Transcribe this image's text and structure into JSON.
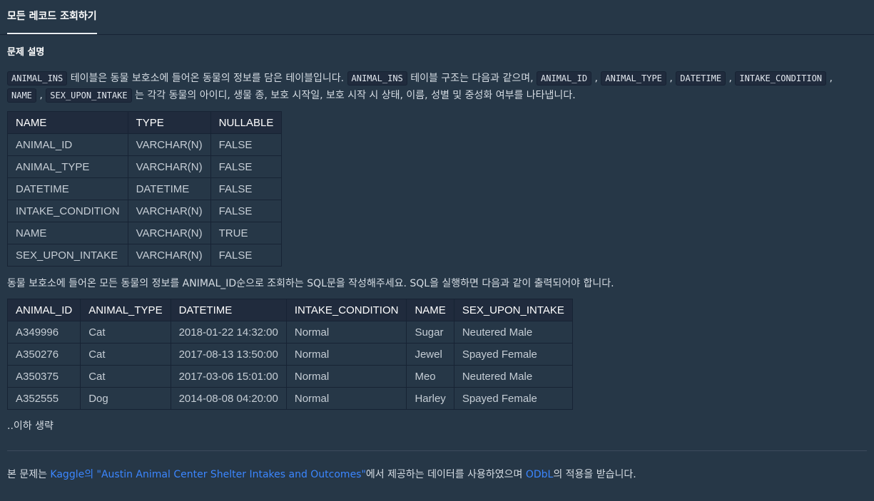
{
  "tab": {
    "label": "모든 레코드 조회하기"
  },
  "section_title": "문제 설명",
  "description": {
    "code_animal_ins": "ANIMAL_INS",
    "text1": " 테이블은 동물 보호소에 들어온 동물의 정보를 담은 테이블입니다. ",
    "code_animal_ins_2": "ANIMAL_INS",
    "text2": " 테이블 구조는 다음과 같으며, ",
    "code_animal_id": "ANIMAL_ID",
    "sep1": " , ",
    "code_animal_type": "ANIMAL_TYPE",
    "sep2": " , ",
    "code_datetime": "DATETIME",
    "sep3": " , ",
    "code_intake_condition": "INTAKE_CONDITION",
    "sep4": " , ",
    "code_name": "NAME",
    "sep5": " , ",
    "code_sex_upon_intake": "SEX_UPON_INTAKE",
    "text3": " 는 각각 동물의 아이디, 생물 종, 보호 시작일, 보호 시작 시 상태, 이름, 성별 및 중성화 여부를 나타냅니다."
  },
  "schema_table": {
    "headers": [
      "NAME",
      "TYPE",
      "NULLABLE"
    ],
    "rows": [
      [
        "ANIMAL_ID",
        "VARCHAR(N)",
        "FALSE"
      ],
      [
        "ANIMAL_TYPE",
        "VARCHAR(N)",
        "FALSE"
      ],
      [
        "DATETIME",
        "DATETIME",
        "FALSE"
      ],
      [
        "INTAKE_CONDITION",
        "VARCHAR(N)",
        "FALSE"
      ],
      [
        "NAME",
        "VARCHAR(N)",
        "TRUE"
      ],
      [
        "SEX_UPON_INTAKE",
        "VARCHAR(N)",
        "FALSE"
      ]
    ]
  },
  "question": "동물 보호소에 들어온 모든 동물의 정보를 ANIMAL_ID순으로 조회하는 SQL문을 작성해주세요. SQL을 실행하면 다음과 같이 출력되어야 합니다.",
  "result_table": {
    "headers": [
      "ANIMAL_ID",
      "ANIMAL_TYPE",
      "DATETIME",
      "INTAKE_CONDITION",
      "NAME",
      "SEX_UPON_INTAKE"
    ],
    "rows": [
      [
        "A349996",
        "Cat",
        "2018-01-22 14:32:00",
        "Normal",
        "Sugar",
        "Neutered Male"
      ],
      [
        "A350276",
        "Cat",
        "2017-08-13 13:50:00",
        "Normal",
        "Jewel",
        "Spayed Female"
      ],
      [
        "A350375",
        "Cat",
        "2017-03-06 15:01:00",
        "Normal",
        "Meo",
        "Neutered Male"
      ],
      [
        "A352555",
        "Dog",
        "2014-08-08 04:20:00",
        "Normal",
        "Harley",
        "Spayed Female"
      ]
    ]
  },
  "omitted": "..이하 생략",
  "footer": {
    "prefix": "본 문제는 ",
    "kaggle_link": "Kaggle의 \"Austin Animal Center Shelter Intakes and Outcomes\"",
    "middle": "에서 제공하는 데이터를 사용하였으며 ",
    "odbl_link": "ODbL",
    "suffix": "의 적용을 받습니다."
  },
  "colors": {
    "background": "#263747",
    "header_cell": "#202b3d",
    "link": "#3b86ff"
  }
}
